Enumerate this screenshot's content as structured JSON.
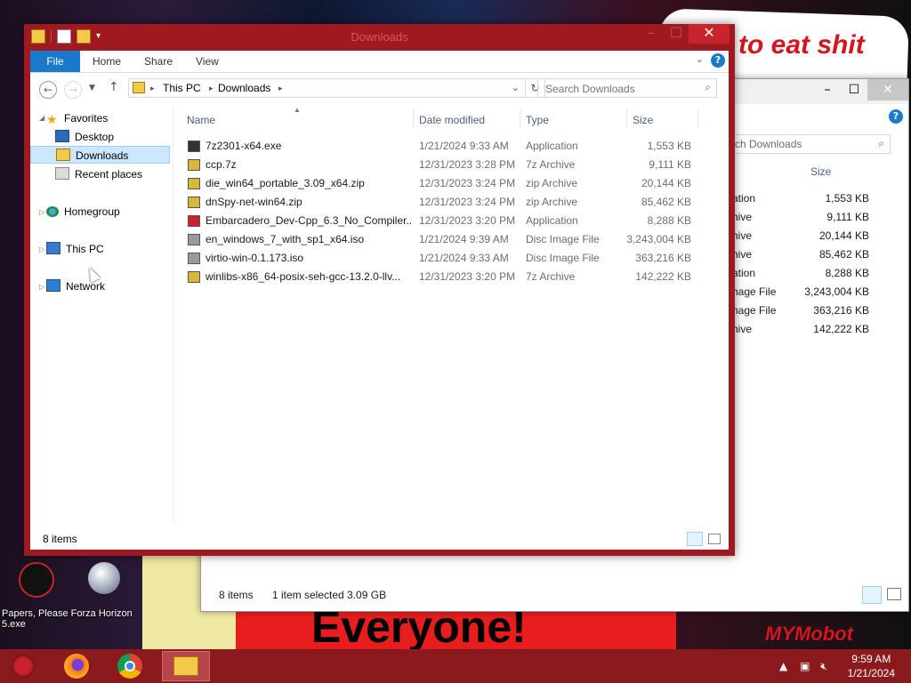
{
  "desktop": {
    "poster_text": "to eat shit",
    "banner_text": "Everyone!",
    "right_sign": "MYMobot",
    "icons": [
      {
        "name": "desktop-icon-papers-please",
        "label": "Papers, Please"
      },
      {
        "name": "desktop-icon-forza",
        "label": "Forza Horizon 5.exe"
      }
    ]
  },
  "back_window": {
    "search_placeholder": "rch Downloads",
    "size_header": "Size",
    "rows": [
      {
        "type": "ation",
        "size": "1,553 KB"
      },
      {
        "type": "hive",
        "size": "9,111 KB"
      },
      {
        "type": "hive",
        "size": "20,144 KB"
      },
      {
        "type": "hive",
        "size": "85,462 KB"
      },
      {
        "type": "ation",
        "size": "8,288 KB"
      },
      {
        "type": "nage File",
        "size": "3,243,004 KB"
      },
      {
        "type": "nage File",
        "size": "363,216 KB"
      },
      {
        "type": "hive",
        "size": "142,222 KB"
      }
    ],
    "status": {
      "count": "8 items",
      "selected": "1 item selected  3.09 GB"
    }
  },
  "window": {
    "title": "Downloads",
    "ribbon": {
      "tabs": [
        {
          "label": "File"
        },
        {
          "label": "Home"
        },
        {
          "label": "Share"
        },
        {
          "label": "View"
        }
      ]
    },
    "address": {
      "segments": [
        "This PC",
        "Downloads"
      ]
    },
    "search": {
      "placeholder": "Search Downloads"
    },
    "nav": {
      "favorites": "Favorites",
      "desktop": "Desktop",
      "downloads": "Downloads",
      "recent": "Recent places",
      "homegroup": "Homegroup",
      "thispc": "This PC",
      "network": "Network"
    },
    "columns": {
      "name": "Name",
      "date": "Date modified",
      "type": "Type",
      "size": "Size"
    },
    "files": [
      {
        "name": "7z2301-x64.exe",
        "date": "1/21/2024 9:33 AM",
        "type": "Application",
        "size": "1,553 KB",
        "icon": "7z-exe-icon",
        "color": "#333333"
      },
      {
        "name": "ccp.7z",
        "date": "12/31/2023 3:28 PM",
        "type": "7z Archive",
        "size": "9,111 KB",
        "icon": "7z-archive-icon",
        "color": "#d7b93a"
      },
      {
        "name": "die_win64_portable_3.09_x64.zip",
        "date": "12/31/2023 3:24 PM",
        "type": "zip Archive",
        "size": "20,144 KB",
        "icon": "zip-archive-icon",
        "color": "#d7b93a"
      },
      {
        "name": "dnSpy-net-win64.zip",
        "date": "12/31/2023 3:24 PM",
        "type": "zip Archive",
        "size": "85,462 KB",
        "icon": "zip-archive-icon",
        "color": "#d7b93a"
      },
      {
        "name": "Embarcadero_Dev-Cpp_6.3_No_Compiler...",
        "date": "12/31/2023 3:20 PM",
        "type": "Application",
        "size": "8,288 KB",
        "icon": "devcpp-app-icon",
        "color": "#c9232b"
      },
      {
        "name": "en_windows_7_with_sp1_x64.iso",
        "date": "1/21/2024 9:39 AM",
        "type": "Disc Image File",
        "size": "3,243,004 KB",
        "icon": "disc-image-icon",
        "color": "#9a9a9a"
      },
      {
        "name": "virtio-win-0.1.173.iso",
        "date": "1/21/2024 9:33 AM",
        "type": "Disc Image File",
        "size": "363,216 KB",
        "icon": "disc-image-icon",
        "color": "#9a9a9a"
      },
      {
        "name": "winlibs-x86_64-posix-seh-gcc-13.2.0-llv...",
        "date": "12/31/2023 3:20 PM",
        "type": "7z Archive",
        "size": "142,222 KB",
        "icon": "7z-archive-icon",
        "color": "#d7b93a"
      }
    ],
    "status": {
      "count": "8 items"
    }
  },
  "taskbar": {
    "items": [
      {
        "name": "taskbar-firefox"
      },
      {
        "name": "taskbar-chrome"
      },
      {
        "name": "taskbar-file-explorer"
      }
    ],
    "time": "9:59 AM",
    "date": "1/21/2024",
    "accent": "#8b1a1e"
  }
}
